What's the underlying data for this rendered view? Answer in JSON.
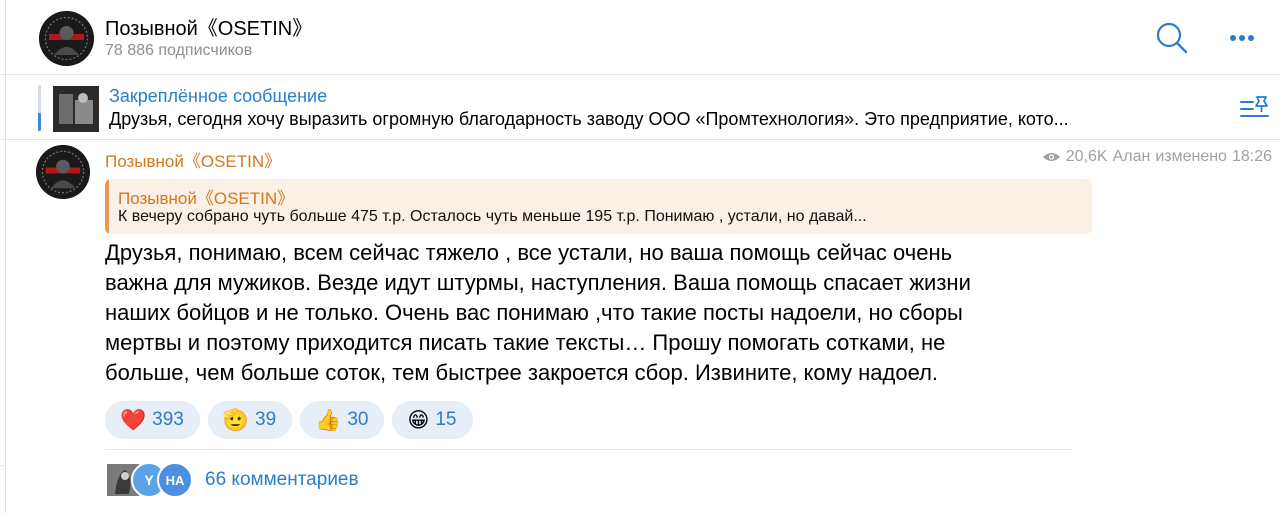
{
  "channel": {
    "title": "Позывной《OSETIN》",
    "subscribers": "78 886 подписчиков"
  },
  "pinned": {
    "title": "Закреплённое сообщение",
    "text": "Друзья, сегодня хочу выразить огромную благодарность заводу ООО «Промтехнология».  Это предприятие, кото..."
  },
  "post": {
    "author": "Позывной《OSETIN》",
    "views": "20,6K",
    "signature": "Алан",
    "edited_label": "изменено",
    "time": "18:26",
    "reply": {
      "author": "Позывной《OSETIN》",
      "text": "К вечеру собрано чуть больше  475 т.р. Осталось чуть меньше  195 т.р. Понимаю , устали, но давай..."
    },
    "body_lines": [
      "Друзья, понимаю, всем сейчас тяжело , все устали, но ваша помощь сейчас очень",
      "важна для мужиков. Везде идут штурмы, наступления. Ваша помощь спасает жизни",
      "наших бойцов и не только. Очень вас понимаю ,что такие посты надоели, но сборы",
      "мертвы и поэтому приходится писать такие тексты… Прошу помогать сотками, не",
      "больше, чем больше соток, тем быстрее закроется сбор. Извините, кому надоел."
    ],
    "reactions": [
      {
        "emoji": "❤️",
        "icon": "heart-icon",
        "count": "393"
      },
      {
        "emoji": "🫡",
        "icon": "salute-icon",
        "count": "39"
      },
      {
        "emoji": "👍",
        "icon": "thumbs-up-icon",
        "count": "30"
      },
      {
        "emoji": "😁",
        "icon": "grin-icon",
        "count": "15"
      }
    ],
    "comments": {
      "avatars": [
        "",
        "Y",
        "НА"
      ],
      "label": "66 комментариев"
    }
  },
  "colors": {
    "accent": "#2481cc",
    "author": "#d3781f",
    "reply_bg": "#fbf0e6",
    "reaction_bg": "#e6eef7"
  }
}
